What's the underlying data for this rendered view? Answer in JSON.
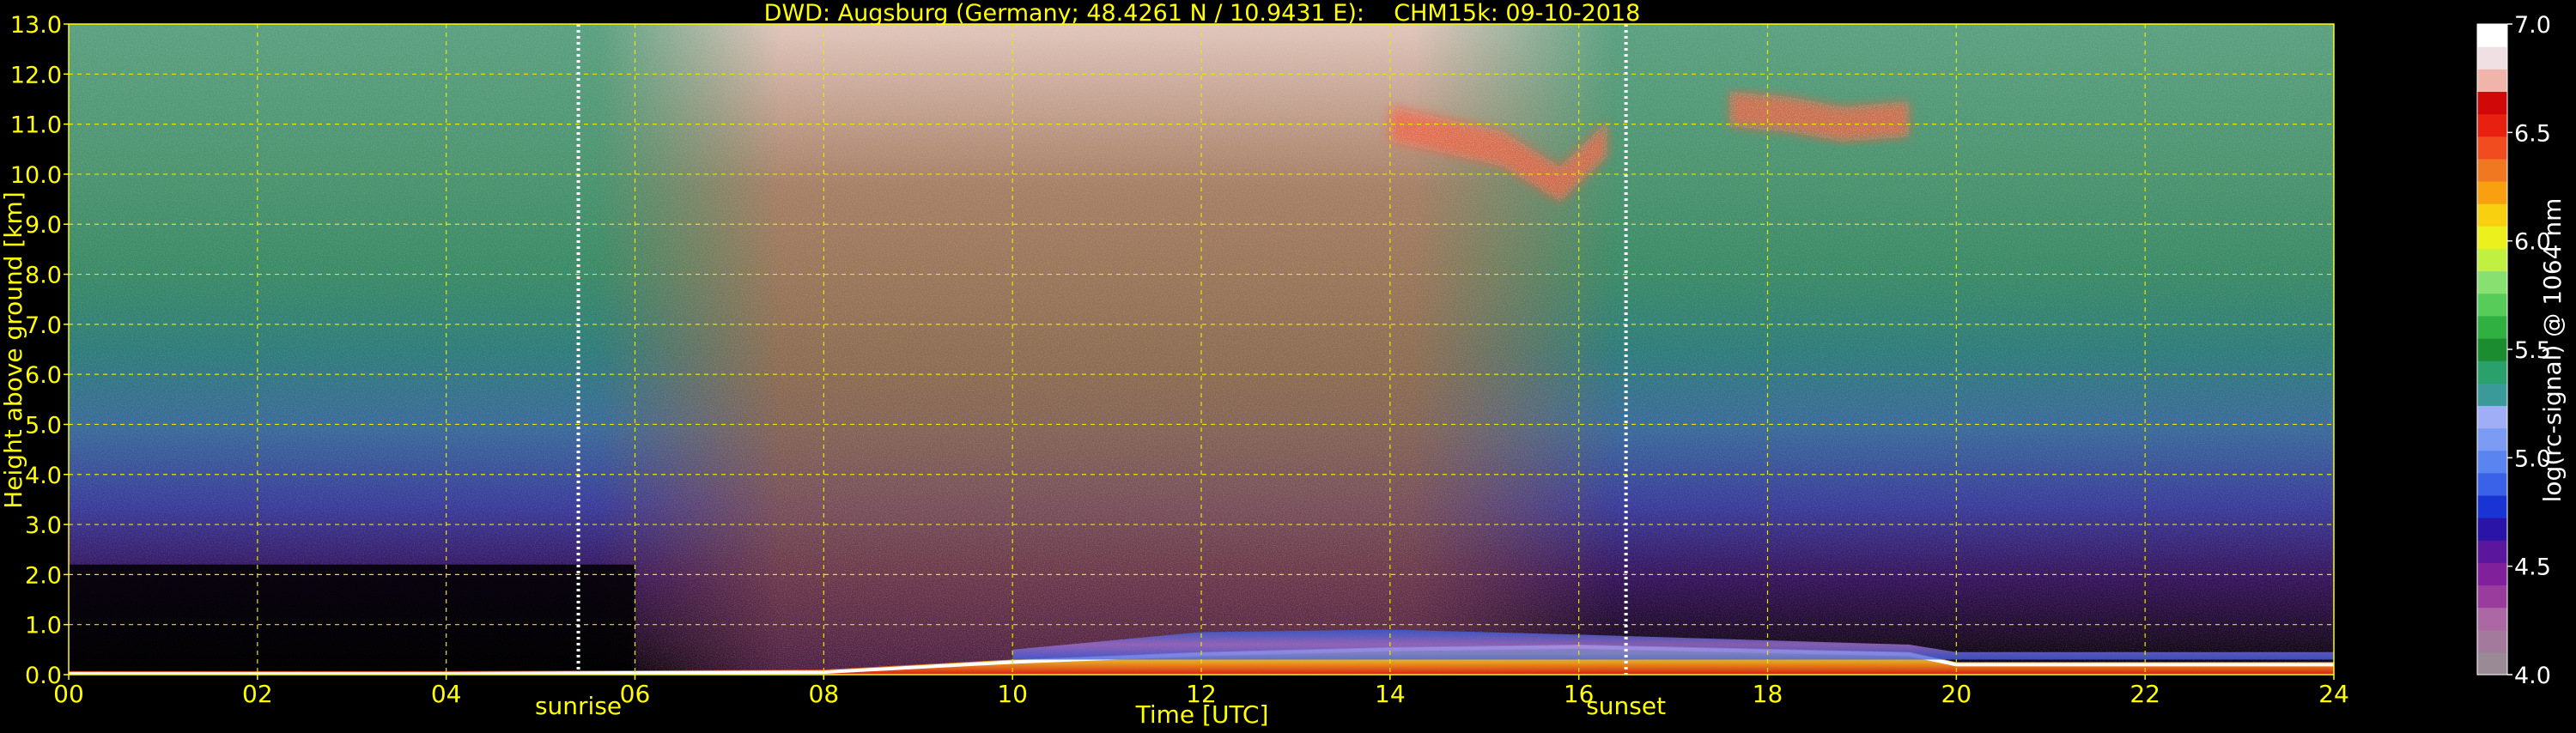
{
  "chart_data": {
    "type": "heatmap",
    "title": "DWD: Augsburg (Germany; 48.4261 N / 10.9431 E):    CHM15k: 09-10-2018",
    "xlabel": "Time [UTC]",
    "ylabel": "Height above ground [km]",
    "xlim": [
      0,
      24
    ],
    "ylim": [
      0,
      13
    ],
    "x_ticks": [
      "00",
      "02",
      "04",
      "06",
      "08",
      "10",
      "12",
      "14",
      "16",
      "18",
      "20",
      "22",
      "24"
    ],
    "y_ticks": [
      "0.0",
      "1.0",
      "2.0",
      "3.0",
      "4.0",
      "5.0",
      "6.0",
      "7.0",
      "8.0",
      "9.0",
      "10.0",
      "11.0",
      "12.0",
      "13.0"
    ],
    "grid": true,
    "colorbar": {
      "label": "log(rc-signal) @ 1064 nm",
      "range": [
        4.0,
        7.0
      ],
      "ticks": [
        "4.0",
        "4.5",
        "5.0",
        "5.5",
        "6.0",
        "6.5",
        "7.0"
      ],
      "colors": [
        "#9a8a96",
        "#a47a9c",
        "#ac68a4",
        "#9a3c9e",
        "#80209a",
        "#5a169c",
        "#2a14a8",
        "#1a34d4",
        "#3a62e8",
        "#5a84f0",
        "#7c9cf4",
        "#a0aef8",
        "#3a9a9a",
        "#2aa06a",
        "#1c8c30",
        "#30b040",
        "#58cc58",
        "#88e070",
        "#c0f040",
        "#ecf01c",
        "#f8d010",
        "#f8a010",
        "#f07820",
        "#f04c20",
        "#e82010",
        "#d00808",
        "#f0b4aa",
        "#f0e0e4",
        "#ffffff"
      ]
    },
    "annotations": [
      {
        "text": "sunrise",
        "x": 5.4
      },
      {
        "text": "sunset",
        "x": 16.5
      }
    ],
    "features": [
      {
        "name": "boundary layer",
        "x": [
          0,
          4,
          8,
          10,
          12,
          14,
          16,
          19.5,
          20,
          24
        ],
        "y": [
          0.02,
          0.02,
          0.05,
          0.25,
          0.4,
          0.5,
          0.55,
          0.4,
          0.2,
          0.2
        ]
      },
      {
        "name": "aerosol layer",
        "x": [
          10,
          12,
          14,
          16,
          19.5,
          20,
          24
        ],
        "y": [
          0.5,
          0.85,
          0.9,
          0.8,
          0.6,
          0.45,
          0.45
        ]
      },
      {
        "name": "cirrus",
        "x": [
          14,
          14.5,
          15.2,
          15.8,
          16.3
        ],
        "y": [
          11.0,
          10.8,
          10.5,
          9.8,
          10.7
        ]
      },
      {
        "name": "cirrus",
        "x": [
          17.6,
          18.2,
          18.8,
          19.5
        ],
        "y": [
          11.3,
          11.2,
          11.0,
          11.1
        ]
      }
    ]
  }
}
